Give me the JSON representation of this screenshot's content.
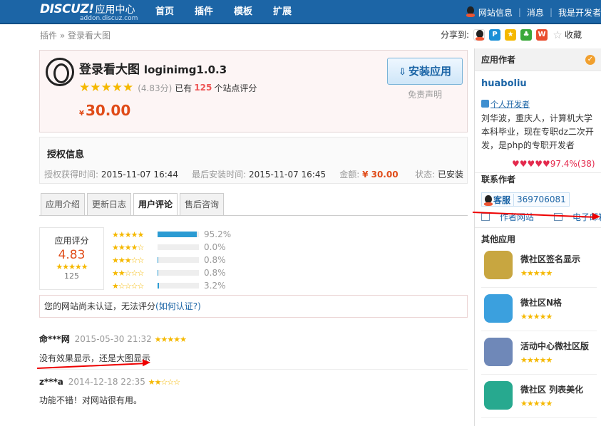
{
  "header": {
    "logo_brand": "DISCUZ!",
    "logo_title": "应用中心",
    "logo_url_text": "addon.discuz.com",
    "nav": [
      "首页",
      "插件",
      "模板",
      "扩展"
    ],
    "site_info": "网站信息",
    "messages": "消息",
    "developer": "我是开发者"
  },
  "breadcrumb": {
    "parent": "插件",
    "sep": "»",
    "current": "登录看大图"
  },
  "share": {
    "label": "分享到:",
    "collect": "收藏"
  },
  "app": {
    "name": "登录看大图",
    "version": "loginimg1.0.3",
    "stars": "★★★★★",
    "score": "(4.83分)",
    "rated_prefix": "已有",
    "rated_count": "125",
    "rated_suffix": "个站点评分",
    "currency": "¥",
    "price": "30.00",
    "install_label": "安装应用",
    "disclaimer": "免责声明"
  },
  "license": {
    "title": "授权信息",
    "obtained_label": "授权获得时间:",
    "obtained": "2015-11-07 16:44",
    "last_install_label": "最后安装时间:",
    "last_install": "2015-11-07 16:45",
    "amount_label": "金额:",
    "amount": "¥ 30.00",
    "status_label": "状态:",
    "status": "已安装"
  },
  "tabs": [
    "应用介绍",
    "更新日志",
    "用户评论",
    "售后咨询"
  ],
  "active_tab": 2,
  "rating": {
    "title": "应用评分",
    "value": "4.83",
    "count": "125",
    "distribution": [
      {
        "stars": "★★★★★",
        "percent": 95.2,
        "label": "95.2%"
      },
      {
        "stars": "★★★★☆",
        "percent": 0.0,
        "label": "0.0%"
      },
      {
        "stars": "★★★☆☆",
        "percent": 0.8,
        "label": "0.8%"
      },
      {
        "stars": "★★☆☆☆",
        "percent": 0.8,
        "label": "0.8%"
      },
      {
        "stars": "★☆☆☆☆",
        "percent": 3.2,
        "label": "3.2%"
      }
    ]
  },
  "notice": {
    "text": "您的网站尚未认证，无法评分",
    "link": "(如何认证?)"
  },
  "comments": [
    {
      "user": "命***网",
      "time": "2015-05-30 21:32",
      "stars": "★★★★★",
      "body": "没有效果显示，还是大图显示"
    },
    {
      "user": "z***a",
      "time": "2014-12-18 22:35",
      "stars": "★★☆☆☆",
      "body": "功能不错！对网站很有用。"
    }
  ],
  "sidebar": {
    "author_header": "应用作者",
    "author_name": "huaboliu",
    "dev_tag": "个人开发者",
    "bio": "刘华波，重庆人，计算机大学本科毕业，现在专职dz二次开发，是php的专职开发者",
    "hearts": "♥♥♥♥♥",
    "good_rate": "97.4%(38)",
    "contact_header": "联系作者",
    "kefu_label": "客服",
    "kefu_qq": "369706081",
    "site_link": "作者网站",
    "email_link": "电子邮箱",
    "other_header": "其他应用",
    "other_apps": [
      {
        "name": "微社区签名显示",
        "stars": "★★★★★",
        "color": "#c8a640"
      },
      {
        "name": "微社区N格",
        "stars": "★★★★★",
        "color": "#3ba0de"
      },
      {
        "name": "活动中心微社区版",
        "stars": "★★★★★",
        "color": "#6f88b8"
      },
      {
        "name": "微社区 列表美化",
        "stars": "★★★★★",
        "color": "#27a98f"
      }
    ]
  },
  "colors": {
    "nav_bg": "#1c65a6",
    "price": "#e04c19",
    "link": "#1c65a6",
    "bar": "#2b9bd3",
    "star": "#f5b800",
    "annotation": "#e00000"
  }
}
